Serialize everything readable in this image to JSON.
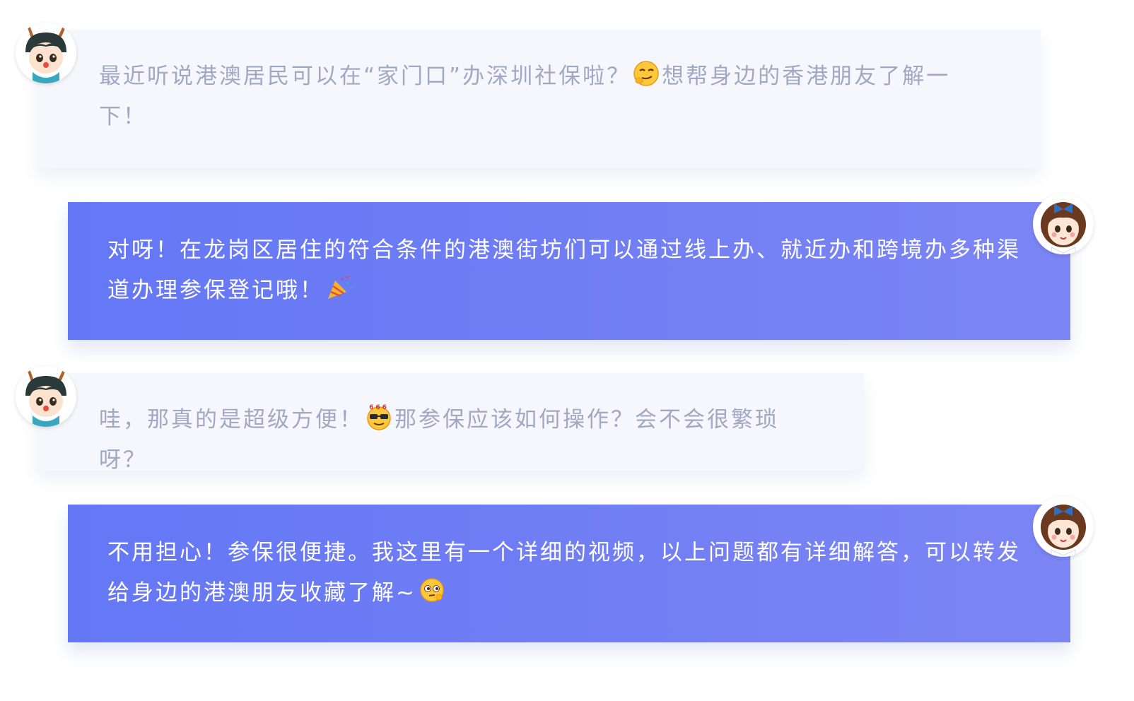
{
  "messages": [
    {
      "side": "left",
      "avatar": "deer-boy-avatar",
      "text_before": "最近听说港澳居民可以在“家门口”办深圳社保啦？",
      "emoji": "sly-smirk-emoji",
      "text_after": "想帮身边的香港朋友了解一下！"
    },
    {
      "side": "right",
      "avatar": "girl-bow-avatar",
      "text_before": "对呀！在龙岗区居住的符合条件的港澳街坊们可以通过线上办、就近办和跨境办多种渠道办理参保登记哦！",
      "emoji": "party-popper-emoji",
      "text_after": ""
    },
    {
      "side": "left",
      "avatar": "deer-boy-avatar",
      "text_before": "哇，那真的是超级方便！",
      "emoji": "sunglasses-666-emoji",
      "text_after": "那参保应该如何操作？会不会很繁琐呀？"
    },
    {
      "side": "right",
      "avatar": "girl-bow-avatar",
      "text_before": "不用担心！参保很便捷。我这里有一个详细的视频，以上问题都有详细解答，可以转发给身边的港澳朋友收藏了解~",
      "emoji": "thinking-face-emoji",
      "text_after": ""
    }
  ],
  "colors": {
    "left_bubble_bg": "#f5f7fc",
    "left_text": "#a3a7c4",
    "right_bubble_start": "#6477f5",
    "right_bubble_end": "#7c85f4",
    "right_text": "#ffffff"
  }
}
